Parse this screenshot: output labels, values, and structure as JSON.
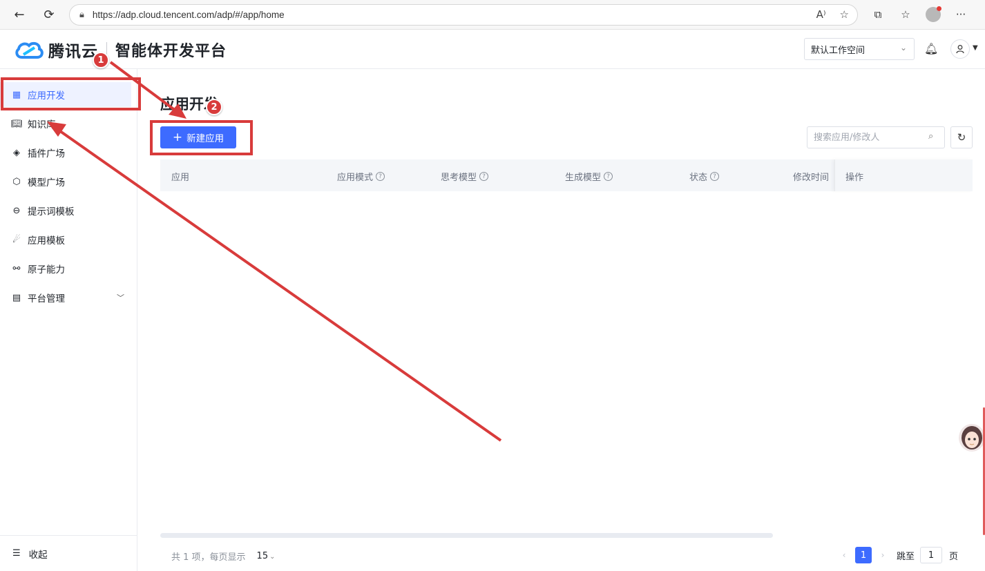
{
  "browser": {
    "url": "https://adp.cloud.tencent.com/adp/#/app/home"
  },
  "header": {
    "brand": "腾讯云",
    "product": "智能体开发平台",
    "workspace": "默认工作空间"
  },
  "sidebar": {
    "items": [
      {
        "label": "应用开发",
        "icon": "grid-icon"
      },
      {
        "label": "知识库",
        "icon": "book-icon"
      },
      {
        "label": "插件广场",
        "icon": "layers-icon"
      },
      {
        "label": "模型广场",
        "icon": "cube-icon"
      },
      {
        "label": "提示词模板",
        "icon": "minus-circle-icon"
      },
      {
        "label": "应用模板",
        "icon": "rocket-icon"
      },
      {
        "label": "原子能力",
        "icon": "link-icon"
      },
      {
        "label": "平台管理",
        "icon": "settings-doc-icon"
      }
    ],
    "collapse_label": "收起"
  },
  "main": {
    "title": "应用开发",
    "new_app_button": "新建应用",
    "search_placeholder": "搜索应用/修改人",
    "columns": [
      "应用",
      "应用模式",
      "思考模型",
      "生成模型",
      "状态",
      "修改时间",
      "操作"
    ]
  },
  "pagination": {
    "summary": "共 1 项，每页显示",
    "page_size": "15",
    "current_page": "1",
    "jump_label": "跳至",
    "jump_value": "1",
    "page_unit": "页"
  },
  "annotations": {
    "step1": "1",
    "step2": "2",
    "color": "#d83b3b"
  },
  "colors": {
    "accent": "#3d6bff",
    "annotation_red": "#d83b3b"
  }
}
